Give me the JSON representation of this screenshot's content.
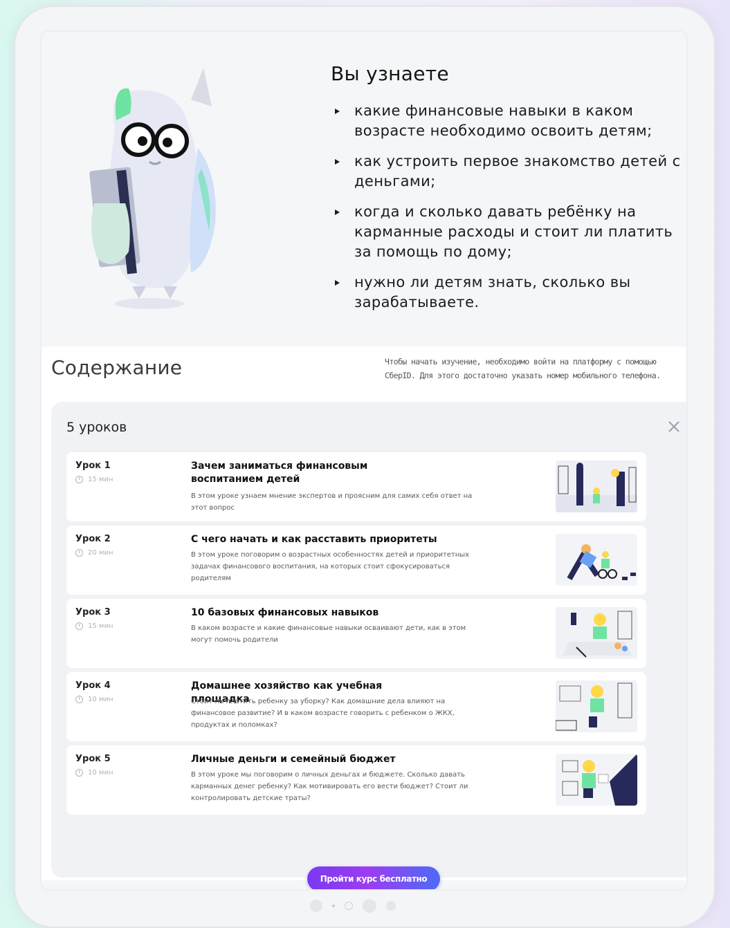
{
  "hero": {
    "title": "Вы узнаете",
    "items": [
      "какие финансовые навыки в каком возрасте необходимо освоить детям;",
      "как устроить первое знакомство детей с деньгами;",
      "когда и сколько давать ребёнку на карманные расходы и стоит ли платить за помощь по дому;",
      "нужно ли детям знать, сколько вы зарабатываете."
    ]
  },
  "content": {
    "title": "Содержание",
    "login_note": "Чтобы начать изучение, необходимо войти на платформу с помощью СберID. Для этого достаточно указать номер мобильного телефона."
  },
  "panel": {
    "title": "5 уроков",
    "lessons": [
      {
        "num": "Урок 1",
        "time": "15 мин",
        "title": "Зачем заниматься финансовым воспитанием детей",
        "desc": "В этом уроке узнаем мнение экспертов и проясним для самих себя ответ на этот вопрос"
      },
      {
        "num": "Урок 2",
        "time": "20 мин",
        "title": "С чего начать и как расставить приоритеты",
        "desc": "В этом уроке поговорим о возрастных особенностях детей и приоритетных задачах финансового воспитания, на которых стоит сфокусироваться родителям"
      },
      {
        "num": "Урок 3",
        "time": "15 мин",
        "title": "10 базовых финансовых навыков",
        "desc": "В каком возрасте и какие финансовые навыки осваивают дети, как в этом могут помочь родители"
      },
      {
        "num": "Урок 4",
        "time": "10 мин",
        "title": "Домашнее хозяйство как учебная площадка",
        "desc": "Стоит ли платить ребенку за уборку? Как домашние дела влияют на финансовое развитие? И в каком возрасте говорить с ребенком о ЖКХ, продуктах и поломках?"
      },
      {
        "num": "Урок 5",
        "time": "10 мин",
        "title": "Личные деньги и семейный бюджет",
        "desc": "В этом уроке мы поговорим о личных деньгах и бюджете. Сколько давать карманных денег ребенку? Как мотивировать его вести бюджет? Стоит ли контролировать детские траты?"
      }
    ],
    "cta": "Пройти курс бесплатно"
  },
  "colors": {
    "accent_start": "#7a3af0",
    "accent_end": "#4d6bf5",
    "owl_body": "#e4e8f5",
    "owl_accent_green": "#6fe3a1"
  }
}
